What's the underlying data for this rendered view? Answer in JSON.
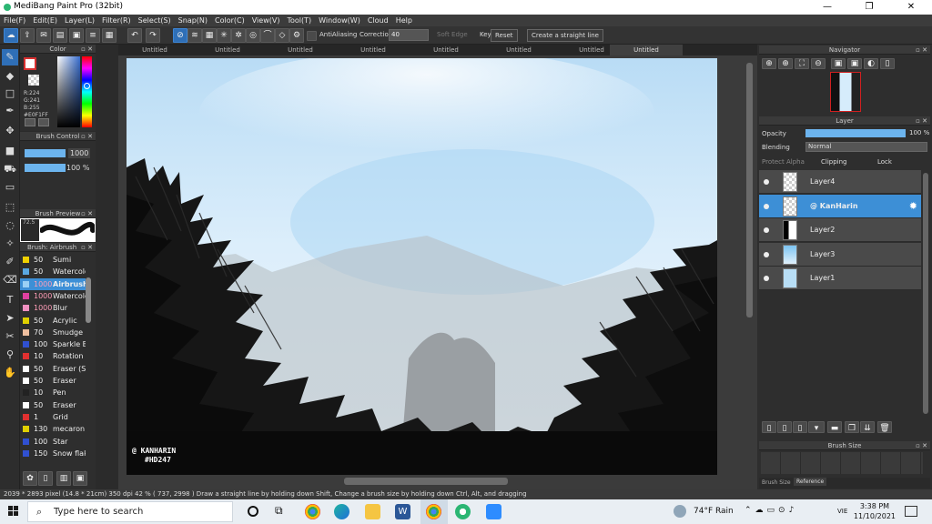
{
  "window": {
    "title": "MediBang Paint Pro (32bit)",
    "controls": [
      "—",
      "❐",
      "✕"
    ]
  },
  "menu": [
    "File(F)",
    "Edit(E)",
    "Layer(L)",
    "Filter(R)",
    "Select(S)",
    "Snap(N)",
    "Color(C)",
    "View(V)",
    "Tool(T)",
    "Window(W)",
    "Cloud",
    "Help"
  ],
  "toolbar": {
    "antialiasing_label": "AntiAliasing",
    "correction_label": "Correction",
    "correction_value": "40",
    "soft_edge_label": "Soft Edge",
    "key_label": "Key",
    "reset_label": "Reset",
    "straight_line_label": "Create a straight line"
  },
  "tabs": [
    "Untitled",
    "Untitled",
    "Untitled",
    "Untitled",
    "Untitled",
    "Untitled",
    "Untitled",
    "Untitled"
  ],
  "color_panel": {
    "title": "Color",
    "rgb": [
      "R:224",
      "G:241",
      "B:255"
    ],
    "hex": "#E0F1FF",
    "current_color": "#E0F1FF"
  },
  "brush_control": {
    "title": "Brush Control",
    "size": "1000",
    "opacity": "100 %"
  },
  "brush_preview": {
    "title": "Brush Preview",
    "value": "72.5"
  },
  "brush_list": {
    "title": "Brush: Airbrush",
    "items": [
      {
        "size": "50",
        "name": "Sumi",
        "color": "#f0d000"
      },
      {
        "size": "50",
        "name": "Watercolor",
        "color": "#5aa7e0"
      },
      {
        "size": "1000",
        "name": "Airbrush",
        "color": "#9ad0f5"
      },
      {
        "size": "1000",
        "name": "Watercolor",
        "color": "#e040a0"
      },
      {
        "size": "1000",
        "name": "Blur",
        "color": "#f090c0"
      },
      {
        "size": "50",
        "name": "Acrylic",
        "color": "#e0d000"
      },
      {
        "size": "70",
        "name": "Smudge",
        "color": "#f0c0a0"
      },
      {
        "size": "100",
        "name": "Sparkle B",
        "color": "#3050d0"
      },
      {
        "size": "10",
        "name": "Rotation",
        "color": "#e03030"
      },
      {
        "size": "50",
        "name": "Eraser (S",
        "color": "#ffffff"
      },
      {
        "size": "50",
        "name": "Eraser",
        "color": "#ffffff"
      },
      {
        "size": "10",
        "name": "Pen",
        "color": "#222222"
      },
      {
        "size": "50",
        "name": "Eraser",
        "color": "#ffffff"
      },
      {
        "size": "1",
        "name": "Grid",
        "color": "#e03030"
      },
      {
        "size": "130",
        "name": "mecaron",
        "color": "#e0d000"
      },
      {
        "size": "100",
        "name": "Star",
        "color": "#3050d0"
      },
      {
        "size": "150",
        "name": "Snow flak",
        "color": "#3050d0"
      }
    ]
  },
  "canvas": {
    "watermark_line1": "@ KANHARIN",
    "watermark_line2": "#HD247"
  },
  "navigator": {
    "title": "Navigator"
  },
  "layer_panel": {
    "title": "Layer",
    "opacity_label": "Opacity",
    "opacity_value": "100 %",
    "blending_label": "Blending",
    "blending_value": "Normal",
    "protect_alpha": "Protect Alpha",
    "clipping": "Clipping",
    "lock": "Lock",
    "layers": [
      {
        "name": "Layer4",
        "active": false
      },
      {
        "name": "@ KanHarin",
        "active": true
      },
      {
        "name": "Layer2",
        "active": false
      },
      {
        "name": "Layer3",
        "active": false
      },
      {
        "name": "Layer1",
        "active": false
      }
    ]
  },
  "brush_size_panel": {
    "title": "Brush Size",
    "tabs": [
      "Brush Size",
      "Reference"
    ]
  },
  "status": {
    "text": "2039 * 2893 pixel   (14.8 * 21cm)   350 dpi   42 %   ( 737, 2998 )   Draw a straight line by holding down Shift, Change a brush size by holding down Ctrl, Alt, and dragging"
  },
  "taskbar": {
    "search_placeholder": "Type here to search",
    "weather": "74°F  Rain",
    "lang": "VIE",
    "time": "3:38 PM",
    "date": "11/10/2021"
  }
}
